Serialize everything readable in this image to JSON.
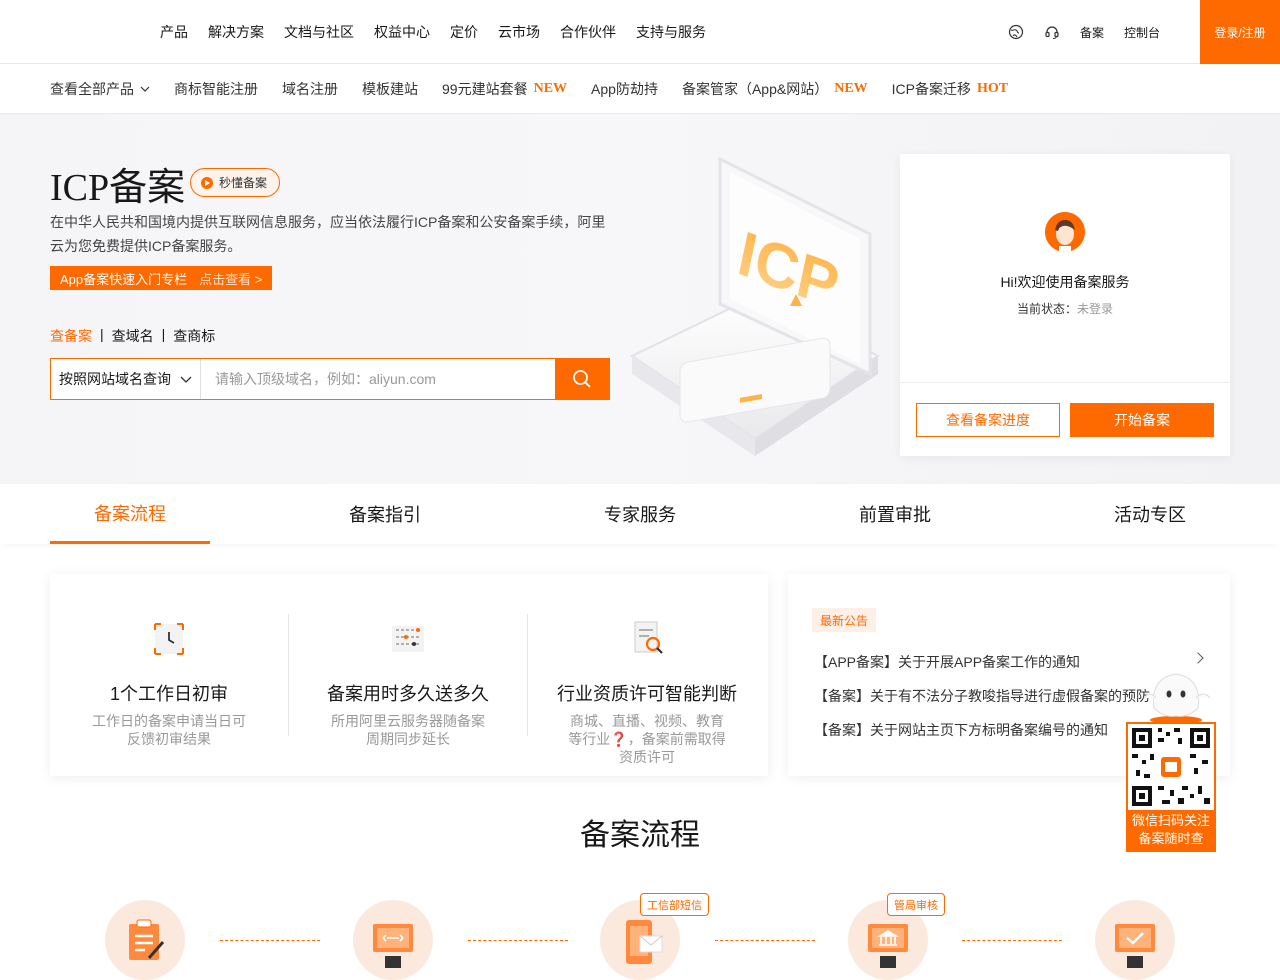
{
  "topnav": {
    "menu": [
      "产品",
      "解决方案",
      "文档与社区",
      "权益中心",
      "定价",
      "云市场",
      "合作伙伴",
      "支持与服务"
    ],
    "right_links": [
      "备案",
      "控制台"
    ],
    "login": "登录/注册"
  },
  "subnav": {
    "items": [
      {
        "label": "查看全部产品",
        "tag": ""
      },
      {
        "label": "商标智能注册",
        "tag": ""
      },
      {
        "label": "域名注册",
        "tag": ""
      },
      {
        "label": "模板建站",
        "tag": ""
      },
      {
        "label": "99元建站套餐",
        "tag": "NEW"
      },
      {
        "label": "App防劫持",
        "tag": ""
      },
      {
        "label": "备案管家（App&网站）",
        "tag": "NEW"
      },
      {
        "label": "ICP备案迁移",
        "tag": "HOT"
      }
    ]
  },
  "hero": {
    "title": "ICP备案",
    "badge": "秒懂备案",
    "desc": "在中华人民共和国境内提供互联网信息服务，应当依法履行ICP备案和公安备案手续，阿里云为您免费提供ICP备案服务。",
    "promo_text": "App备案快速入门专栏",
    "promo_link": "点击查看 >",
    "query_tabs": [
      "查备案",
      "查域名",
      "查商标"
    ],
    "search_select": "按照网站域名查询",
    "search_placeholder": "请输入顶级域名，例如：aliyun.com",
    "illustration_text": "ICP"
  },
  "card": {
    "welcome": "Hi!欢迎使用备案服务",
    "status_label": "当前状态：",
    "status_value": "未登录",
    "btn_progress": "查看备案进度",
    "btn_start": "开始备案"
  },
  "tabs": [
    "备案流程",
    "备案指引",
    "专家服务",
    "前置审批",
    "活动专区"
  ],
  "features": [
    {
      "title": "1个工作日初审",
      "desc": "工作日的备案申请当日可反馈初审结果"
    },
    {
      "title": "备案用时多久送多久",
      "desc": "所用阿里云服务器随备案周期同步延长"
    },
    {
      "title": "行业资质许可智能判断",
      "desc": "商城、直播、视频、教育等行业❓，备案前需取得资质许可"
    }
  ],
  "notice": {
    "label": "最新公告",
    "items": [
      "【APP备案】关于开展APP备案工作的通知",
      "【备案】关于有不法分子教唆指导进行虚假备案的预防",
      "【备案】关于网站主页下方标明备案编号的通知"
    ]
  },
  "qr": {
    "caption_1": "微信扫码关注",
    "caption_2": "备案随时查"
  },
  "process": {
    "title": "备案流程",
    "tags": [
      "工信部短信",
      "管局审核"
    ]
  },
  "colors": {
    "accent": "#ff6a00",
    "accent_light": "#fef0e6"
  }
}
